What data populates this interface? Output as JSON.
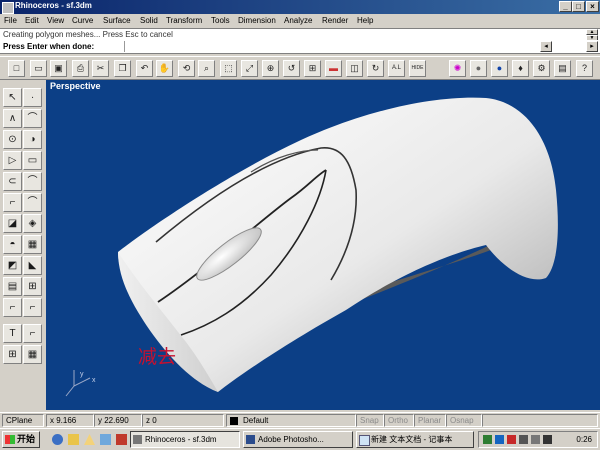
{
  "window": {
    "title": "Rhinoceros - sf.3dm",
    "min_glyph": "_",
    "max_glyph": "□",
    "close_glyph": "×"
  },
  "menu": [
    "File",
    "Edit",
    "View",
    "Curve",
    "Surface",
    "Solid",
    "Transform",
    "Tools",
    "Dimension",
    "Analyze",
    "Render",
    "Help"
  ],
  "command": {
    "history": "Creating polygon meshes... Press Esc to cancel",
    "prompt": "Press Enter when done:",
    "scroll_left": "◂",
    "scroll_right": "▸",
    "scroll_up": "▲",
    "scroll_down": "▼"
  },
  "toolbar": [
    {
      "name": "new-icon",
      "glyph": "□"
    },
    {
      "name": "open-icon",
      "glyph": "▭"
    },
    {
      "name": "save-icon",
      "glyph": "▣"
    },
    {
      "name": "print-icon",
      "glyph": "⎙"
    },
    {
      "name": "cut-icon",
      "glyph": "✂"
    },
    {
      "name": "copy-icon",
      "glyph": "❐"
    },
    {
      "name": "undo-icon",
      "glyph": "↶"
    },
    {
      "name": "pan-icon",
      "glyph": "✋"
    },
    {
      "name": "rotate-view-icon",
      "glyph": "⟲"
    },
    {
      "name": "zoom-icon",
      "glyph": "⌕"
    },
    {
      "name": "zoom-window-icon",
      "glyph": "⬚"
    },
    {
      "name": "zoom-extents-icon",
      "glyph": "⤢"
    },
    {
      "name": "zoom-selected-icon",
      "glyph": "⊕"
    },
    {
      "name": "undo-view-icon",
      "glyph": "↺"
    },
    {
      "name": "four-viewports-icon",
      "glyph": "⊞"
    },
    {
      "name": "car-icon",
      "glyph": "▬"
    },
    {
      "name": "select-icon",
      "glyph": "◫"
    },
    {
      "name": "rebuild-icon",
      "glyph": "↻"
    },
    {
      "name": "layer-icon",
      "glyph": "A.L"
    },
    {
      "name": "hide-icon",
      "glyph": "HIDE"
    },
    {
      "name": "color-wheel-icon",
      "glyph": "✺"
    },
    {
      "name": "render-sphere-icon",
      "glyph": "●"
    },
    {
      "name": "shade-sphere-icon",
      "glyph": "●"
    },
    {
      "name": "light-icon",
      "glyph": "♦"
    },
    {
      "name": "options-icon",
      "glyph": "⚙"
    },
    {
      "name": "properties-icon",
      "glyph": "▤"
    },
    {
      "name": "help-icon",
      "glyph": "?"
    }
  ],
  "toolbox": [
    "↖",
    "∙",
    "∧",
    "⌒",
    "⊙",
    "◑",
    "▷",
    "▭",
    "⊂",
    "⌒",
    "⌐",
    "⌒",
    "◪",
    "◈",
    "◓",
    "▦",
    "◩",
    "◣",
    "▤",
    "⊞",
    "⌐",
    "⌐",
    "T",
    "⌐",
    "⊞",
    "▦"
  ],
  "viewport": {
    "label": "Perspective",
    "annotation": "减去",
    "axis_x": "x",
    "axis_y": "y"
  },
  "status": {
    "cplane": "CPlane",
    "x": "x 9.166",
    "y": "y 22.690",
    "z": "z 0",
    "layer": "Default",
    "snap": "Snap",
    "ortho": "Ortho",
    "planar": "Planar",
    "osnap": "Osnap"
  },
  "taskbar": {
    "start": "开始",
    "tasks": [
      "Rhinoceros - sf.3dm",
      "Adobe Photosho...",
      "新建 文本文档 - 记事本"
    ],
    "clock": "0:26"
  },
  "colors": {
    "viewport_bg": "#0c3f86",
    "title_bar": "#0a246a",
    "annotation": "#c8102e"
  }
}
